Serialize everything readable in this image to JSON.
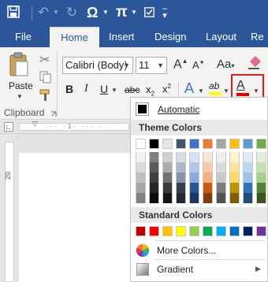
{
  "quick_access": {
    "omega": "Ω",
    "pi": "π"
  },
  "tabs": [
    {
      "label": "File"
    },
    {
      "label": "Home"
    },
    {
      "label": "Insert"
    },
    {
      "label": "Design"
    },
    {
      "label": "Layout"
    },
    {
      "label": "Re"
    }
  ],
  "ribbon": {
    "paste_label": "Paste",
    "clipboard_group": "Clipboard",
    "font_name": "Calibri (Body)",
    "font_size": "11",
    "bold": "B",
    "italic": "I",
    "underline": "U",
    "strike": "abc",
    "subscript": "x",
    "superscript": "x",
    "text_effects": "A",
    "highlight": "ab",
    "font_color": "A"
  },
  "ruler": {
    "vertical_mark": "20"
  },
  "color_menu": {
    "automatic": "Automatic",
    "theme_header": "Theme Colors",
    "standard_header": "Standard Colors",
    "more_colors": "More Colors...",
    "gradient": "Gradient",
    "theme_columns": [
      [
        "#ffffff",
        "#f2f2f2",
        "#d9d9d9",
        "#bfbfbf",
        "#a6a6a6",
        "#808080"
      ],
      [
        "#000000",
        "#7f7f7f",
        "#595959",
        "#3f3f3f",
        "#262626",
        "#0c0c0c"
      ],
      [
        "#e7e6e6",
        "#d0cece",
        "#aeabab",
        "#757171",
        "#3a3838",
        "#171616"
      ],
      [
        "#44546a",
        "#d6dce4",
        "#adb9ca",
        "#8496b0",
        "#333f4f",
        "#222a35"
      ],
      [
        "#4472c4",
        "#d9e2f3",
        "#b4c6e7",
        "#8eaadb",
        "#2f5496",
        "#1f3864"
      ],
      [
        "#ed7d31",
        "#fbe5d5",
        "#f7cbac",
        "#f4b183",
        "#c55a11",
        "#843c0b"
      ],
      [
        "#a5a5a5",
        "#ededed",
        "#dbdbdb",
        "#c9c9c9",
        "#7b7b7b",
        "#525252"
      ],
      [
        "#ffc000",
        "#fff2cc",
        "#ffe599",
        "#ffd966",
        "#bf9000",
        "#7f6000"
      ],
      [
        "#5b9bd5",
        "#deebf6",
        "#bdd7ee",
        "#9dc3e6",
        "#2e75b5",
        "#1f4e79"
      ],
      [
        "#70ad47",
        "#e2efd9",
        "#c5e0b3",
        "#a8d08d",
        "#538135",
        "#375623"
      ]
    ],
    "standard_colors": [
      "#c00000",
      "#ff0000",
      "#ffc000",
      "#ffff00",
      "#92d050",
      "#00b050",
      "#00b0f0",
      "#0070c0",
      "#002060",
      "#7030a0"
    ]
  }
}
